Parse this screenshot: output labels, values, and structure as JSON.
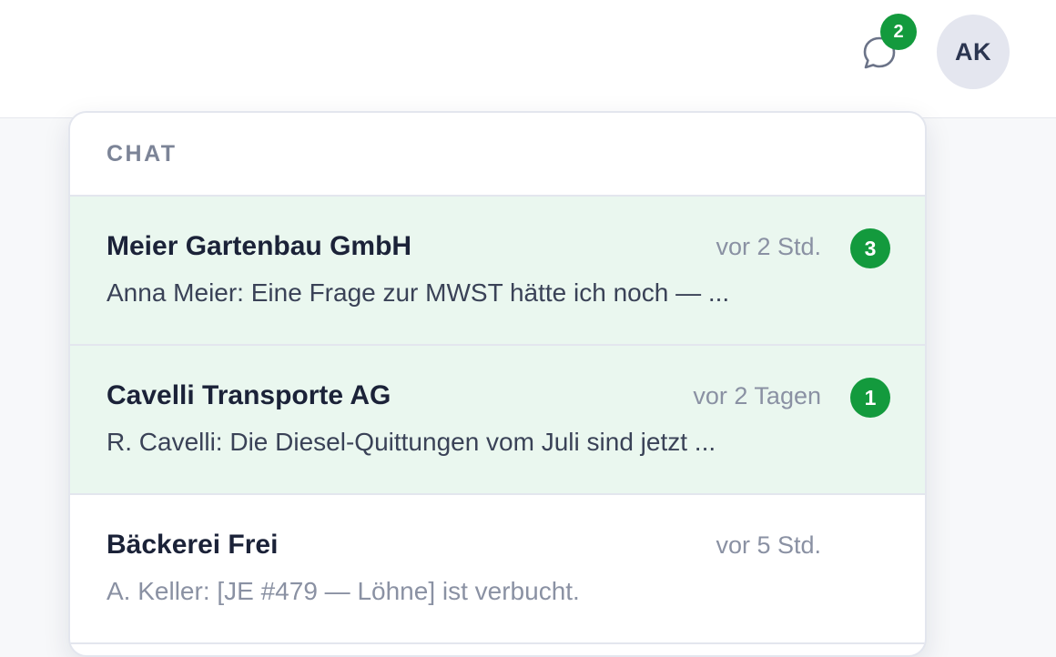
{
  "header": {
    "chat_unread_count": "2",
    "avatar_initials": "AK"
  },
  "chat_panel": {
    "title": "CHAT",
    "conversations": [
      {
        "name": "Meier Gartenbau GmbH",
        "time": "vor 2 Std.",
        "unread": "3",
        "preview": "Anna Meier: Eine Frage zur MWST hätte ich noch — ..."
      },
      {
        "name": "Cavelli Transporte AG",
        "time": "vor 2 Tagen",
        "unread": "1",
        "preview": "R. Cavelli: Die Diesel-Quittungen vom Juli sind jetzt ..."
      },
      {
        "name": "Bäckerei Frei",
        "time": "vor 5 Std.",
        "preview": "A. Keller: [JE #479 — Löhne] ist verbucht."
      }
    ]
  },
  "colors": {
    "accent_green": "#139a3d",
    "unread_row_bg": "#eaf7ef",
    "avatar_bg": "#e4e6ef"
  },
  "icons": {
    "chat": "chat-bubble-icon"
  }
}
